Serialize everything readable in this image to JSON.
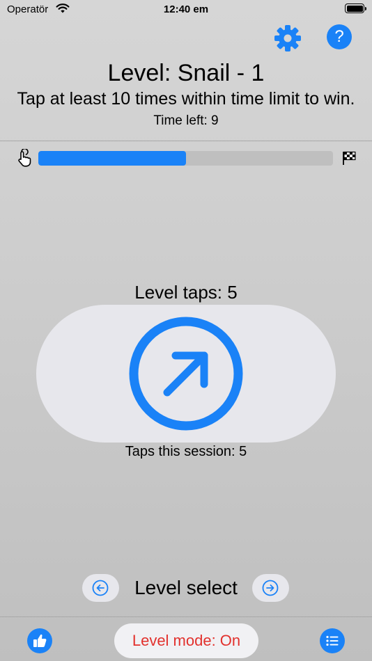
{
  "status_bar": {
    "carrier": "Operatör",
    "time": "12:40 em"
  },
  "header": {
    "level_title": "Level: Snail - 1",
    "instructions": "Tap at least 10 times within time limit to win.",
    "time_left": "Time left: 9"
  },
  "progress": {
    "fraction": 0.5
  },
  "tap_area": {
    "level_taps": "Level taps: 5",
    "session_taps": "Taps this session: 5"
  },
  "level_nav": {
    "label": "Level select"
  },
  "bottom_bar": {
    "mode_label": "Level mode: On"
  },
  "icons": {
    "settings": "gear-icon",
    "help": "question-icon",
    "tap": "hand-tap-icon",
    "finish": "checkered-flag-icon",
    "tap_button": "arrow-up-right-circle-icon",
    "prev": "arrow-left-circle-icon",
    "next": "arrow-right-circle-icon",
    "like": "thumbs-up-icon",
    "list": "list-icon"
  },
  "colors": {
    "accent": "#1a82f7",
    "mode_text": "#e2312d",
    "pill": "#e7e7ec"
  },
  "help_glyph": "?"
}
